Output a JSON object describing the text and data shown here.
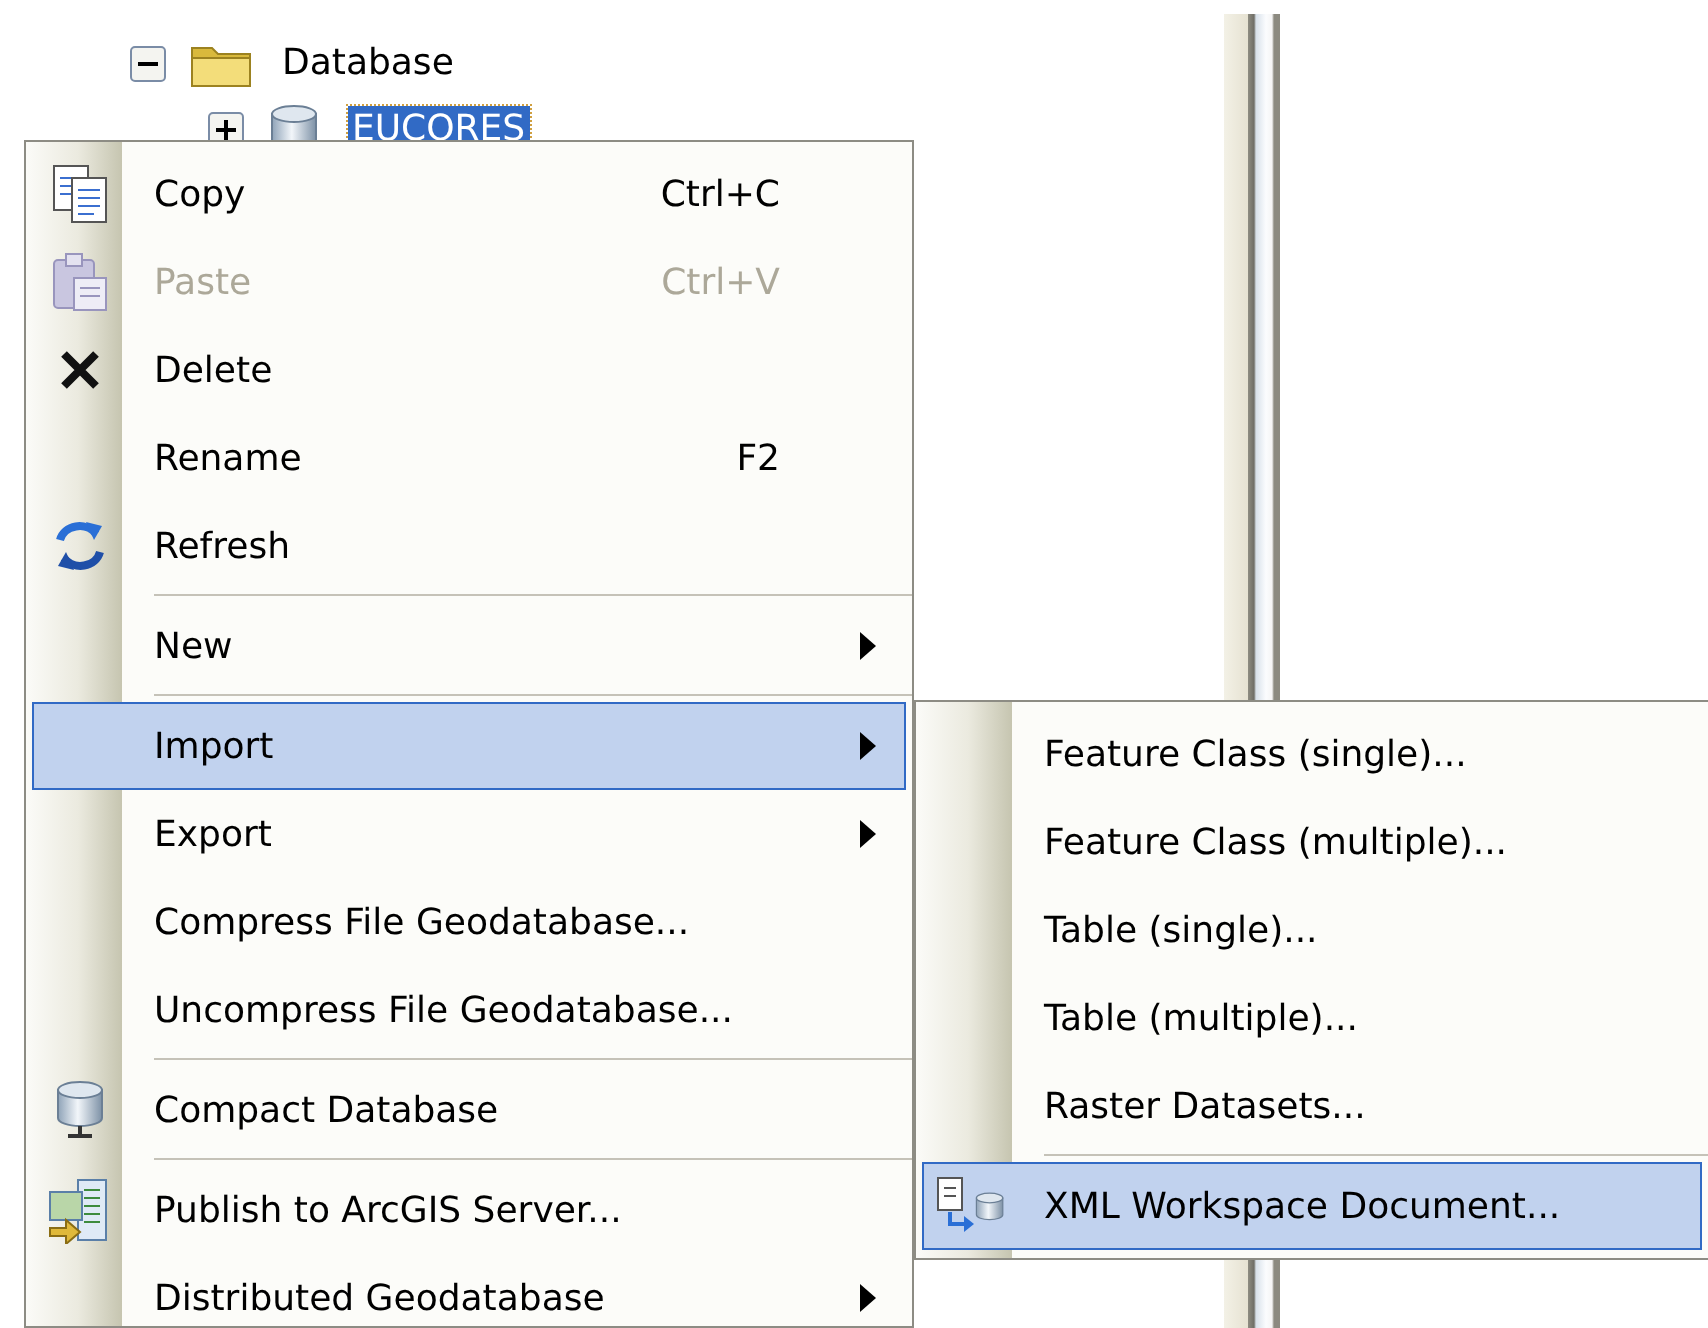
{
  "tree": [
    {
      "label": "Database",
      "expanded": true,
      "selected": false,
      "children": [
        {
          "label": "EUCORES",
          "expanded": false,
          "selected": true
        }
      ]
    }
  ],
  "context_menu": {
    "items": [
      {
        "kind": "item",
        "label": "Copy",
        "shortcut": "Ctrl+C",
        "disabled": false,
        "selected": false,
        "has_submenu": false
      },
      {
        "kind": "item",
        "label": "Paste",
        "shortcut": "Ctrl+V",
        "disabled": true,
        "selected": false,
        "has_submenu": false
      },
      {
        "kind": "item",
        "label": "Delete",
        "disabled": false,
        "selected": false,
        "has_submenu": false
      },
      {
        "kind": "item",
        "label": "Rename",
        "shortcut": "F2",
        "disabled": false,
        "selected": false,
        "has_submenu": false
      },
      {
        "kind": "item",
        "label": "Refresh",
        "disabled": false,
        "selected": false,
        "has_submenu": false
      },
      {
        "kind": "separator"
      },
      {
        "kind": "item",
        "label": "New",
        "disabled": false,
        "selected": false,
        "has_submenu": true
      },
      {
        "kind": "separator"
      },
      {
        "kind": "item",
        "label": "Import",
        "disabled": false,
        "selected": true,
        "has_submenu": true
      },
      {
        "kind": "item",
        "label": "Export",
        "disabled": false,
        "selected": false,
        "has_submenu": true
      },
      {
        "kind": "item",
        "label": "Compress File Geodatabase...",
        "disabled": false,
        "selected": false,
        "has_submenu": false
      },
      {
        "kind": "item",
        "label": "Uncompress File Geodatabase...",
        "disabled": false,
        "selected": false,
        "has_submenu": false
      },
      {
        "kind": "separator"
      },
      {
        "kind": "item",
        "label": "Compact Database",
        "disabled": false,
        "selected": false,
        "has_submenu": false
      },
      {
        "kind": "separator"
      },
      {
        "kind": "item",
        "label": "Publish to ArcGIS Server...",
        "disabled": false,
        "selected": false,
        "has_submenu": false
      },
      {
        "kind": "item",
        "label": "Distributed Geodatabase",
        "disabled": false,
        "selected": false,
        "has_submenu": true
      }
    ]
  },
  "submenu": {
    "items": [
      {
        "kind": "item",
        "label": "Feature Class (single)...",
        "disabled": false,
        "selected": false,
        "has_submenu": false
      },
      {
        "kind": "item",
        "label": "Feature Class (multiple)...",
        "disabled": false,
        "selected": false,
        "has_submenu": false
      },
      {
        "kind": "item",
        "label": "Table (single)...",
        "disabled": false,
        "selected": false,
        "has_submenu": false
      },
      {
        "kind": "item",
        "label": "Table (multiple)...",
        "disabled": false,
        "selected": false,
        "has_submenu": false
      },
      {
        "kind": "item",
        "label": "Raster Datasets...",
        "disabled": false,
        "selected": false,
        "has_submenu": false
      },
      {
        "kind": "separator"
      },
      {
        "kind": "item",
        "label": "XML Workspace Document...",
        "disabled": false,
        "selected": true,
        "has_submenu": false
      }
    ]
  }
}
